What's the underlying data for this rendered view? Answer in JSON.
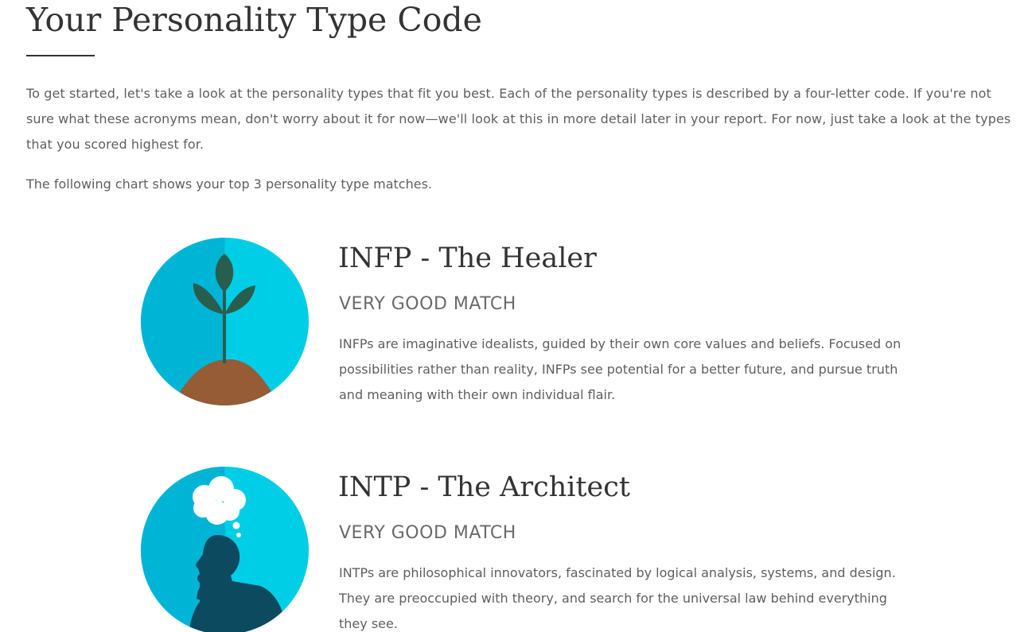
{
  "page": {
    "title": "Your Personality Type Code",
    "intro": "To get started, let's take a look at the personality types that fit you best. Each of the personality types is described by a four-letter code. If you're not sure what these acronyms mean, don't worry about it for now—we'll look at this in more detail later in your report. For now, just take a look at the types that you scored highest for.",
    "chart_note": "The following chart shows your top 3 personality type matches."
  },
  "types": [
    {
      "name": "INFP - The Healer",
      "match": "VERY GOOD MATCH",
      "description": "INFPs are imaginative idealists, guided by their own core values and beliefs. Focused on possibilities rather than reality, INFPs see potential for a better future, and pursue truth and meaning with their own individual flair.",
      "icon": "sprout-icon"
    },
    {
      "name": "INTP - The Architect",
      "match": "VERY GOOD MATCH",
      "description": "INTPs are philosophical innovators, fascinated by logical analysis, systems, and design. They are preoccupied with theory, and search for the universal law behind everything they see.",
      "icon": "thinker-icon"
    }
  ],
  "colors": {
    "circle_light": "#00cde6",
    "circle_dark": "#00b4d6",
    "leaf": "#285e4e",
    "soil": "#955c35",
    "thinker": "#0c4a60",
    "cloud": "#ffffff"
  }
}
